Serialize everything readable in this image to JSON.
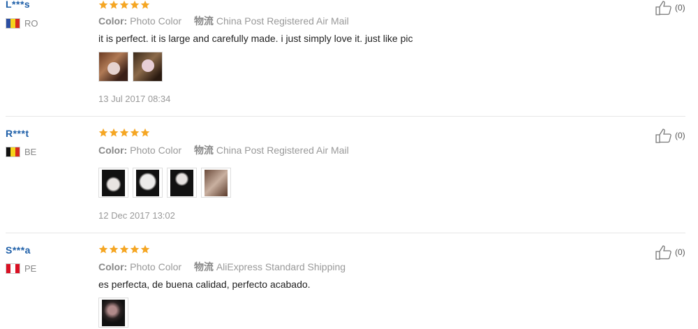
{
  "reviews": [
    {
      "user": "L***s",
      "country_code": "RO",
      "color_label": "Color:",
      "color_value": "Photo Color",
      "shipping_label": "物流",
      "shipping_value": "China Post Registered Air Mail",
      "text": "it is perfect. it is large and carefully made. i just simply love it. just like pic",
      "date": "13 Jul 2017 08:34",
      "likes": "(0)",
      "rating": 5
    },
    {
      "user": "R***t",
      "country_code": "BE",
      "color_label": "Color:",
      "color_value": "Photo Color",
      "shipping_label": "物流",
      "shipping_value": "China Post Registered Air Mail",
      "text": "",
      "date": "12 Dec 2017 13:02",
      "likes": "(0)",
      "rating": 5
    },
    {
      "user": "S***a",
      "country_code": "PE",
      "color_label": "Color:",
      "color_value": "Photo Color",
      "shipping_label": "物流",
      "shipping_value": "AliExpress Standard Shipping",
      "text": "es perfecta, de buena calidad, perfecto acabado.",
      "date": "",
      "likes": "(0)",
      "rating": 5
    }
  ],
  "colors": {
    "star": "#f5a623",
    "username": "#1e5fa8",
    "divider": "#e6e6e6"
  }
}
